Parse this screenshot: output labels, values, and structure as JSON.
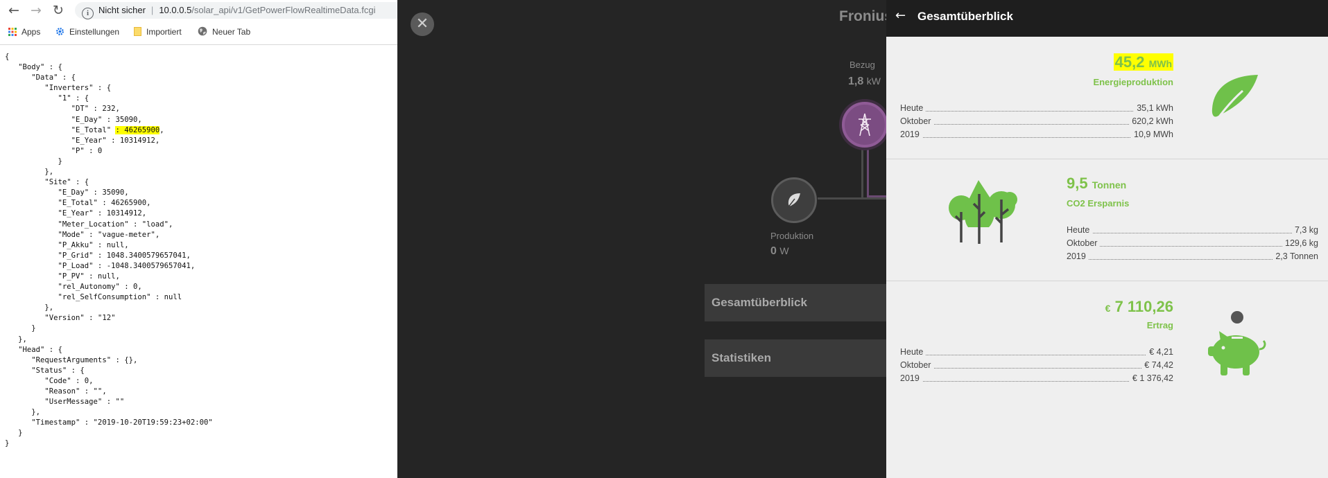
{
  "browser": {
    "nav": {
      "back_icon": "arrow-left-icon",
      "forward_icon": "arrow-right-icon",
      "reload_icon": "reload-icon"
    },
    "omnibox": {
      "security_label": "Nicht sicher",
      "url_host": "10.0.0.5",
      "url_path": "/solar_api/v1/GetPowerFlowRealtimeData.fcgi"
    },
    "bookmarks": [
      {
        "label": "Apps",
        "icon": "apps-grid-icon"
      },
      {
        "label": "Einstellungen",
        "icon": "gear-icon"
      },
      {
        "label": "Importiert",
        "icon": "folder-icon"
      },
      {
        "label": "Neuer Tab",
        "icon": "globe-icon"
      }
    ],
    "json_before": "{\n   \"Body\" : {\n      \"Data\" : {\n         \"Inverters\" : {\n            \"1\" : {\n               \"DT\" : 232,\n               \"E_Day\" : 35090,\n               \"E_Total\" ",
    "json_highlight": ": 46265900",
    "json_after": ",\n               \"E_Year\" : 10314912,\n               \"P\" : 0\n            }\n         },\n         \"Site\" : {\n            \"E_Day\" : 35090,\n            \"E_Total\" : 46265900,\n            \"E_Year\" : 10314912,\n            \"Meter_Location\" : \"load\",\n            \"Mode\" : \"vague-meter\",\n            \"P_Akku\" : null,\n            \"P_Grid\" : 1048.3400579657041,\n            \"P_Load\" : -1048.3400579657041,\n            \"P_PV\" : null,\n            \"rel_Autonomy\" : 0,\n            \"rel_SelfConsumption\" : null\n         },\n         \"Version\" : \"12\"\n      }\n   },\n   \"Head\" : {\n      \"RequestArguments\" : {},\n      \"Status\" : {\n         \"Code\" : 0,\n         \"Reason\" : \"\",\n         \"UserMessage\" : \"\"\n      },\n      \"Timestamp\" : \"2019-10-20T19:59:23+02:00\"\n   }\n}"
  },
  "app": {
    "close_icon": "close-icon",
    "title": "Fronius",
    "bezug": {
      "label": "Bezug",
      "value": "1,8",
      "unit": "kW",
      "icon": "power-pylon-icon"
    },
    "produktion": {
      "label": "Produktion",
      "value": "0",
      "unit": "W",
      "icon": "leaf-icon"
    },
    "menu": [
      {
        "label": "Gesamtüberblick"
      },
      {
        "label": "Statistiken"
      }
    ]
  },
  "panel": {
    "back_icon": "arrow-left-icon",
    "title": "Gesamtüberblick",
    "accent_color": "#7ec24a",
    "energy": {
      "value": "45,2",
      "unit": "MWh",
      "label": "Energieproduktion",
      "icon": "leaf-icon",
      "rows": [
        {
          "label": "Heute",
          "value": "35,1  kWh"
        },
        {
          "label": "Oktober",
          "value": "620,2  kWh"
        },
        {
          "label": "2019",
          "value": "10,9  MWh"
        }
      ]
    },
    "co2": {
      "value": "9,5",
      "unit": "Tonnen",
      "label": "CO2 Ersparnis",
      "icon": "trees-icon",
      "rows": [
        {
          "label": "Heute",
          "value": "7,3 kg"
        },
        {
          "label": "Oktober",
          "value": "129,6 kg"
        },
        {
          "label": "2019",
          "value": "2,3 Tonnen"
        }
      ]
    },
    "ertrag": {
      "currency": "€",
      "value": "7 110,26",
      "label": "Ertrag",
      "icon": "piggy-bank-icon",
      "rows": [
        {
          "label": "Heute",
          "value": "€ 4,21"
        },
        {
          "label": "Oktober",
          "value": "€ 74,42"
        },
        {
          "label": "2019",
          "value": "€ 1 376,42"
        }
      ]
    }
  }
}
